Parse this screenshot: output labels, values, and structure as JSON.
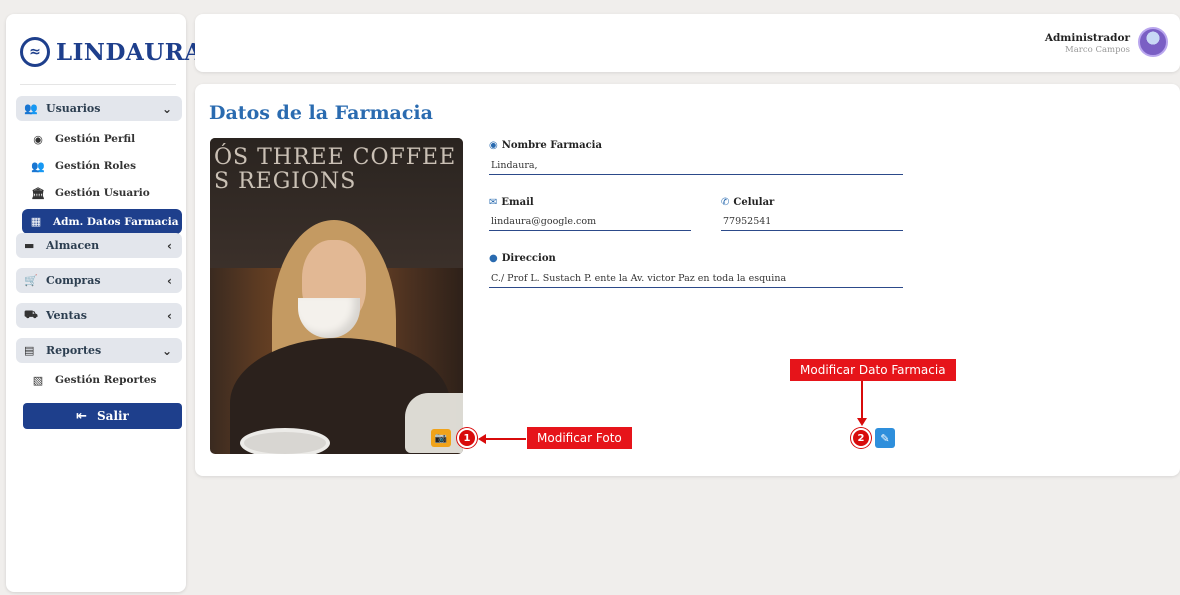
{
  "brand": {
    "name": "LINDAURA",
    "logo_icon": "lindaura-logo-icon"
  },
  "sidebar": {
    "groups": [
      {
        "label": "Usuarios",
        "icon": "users-icon",
        "chevron": "chevron-down-icon"
      },
      {
        "label": "Almacen",
        "icon": "store-icon",
        "chevron": "chevron-left-icon"
      },
      {
        "label": "Compras",
        "icon": "cart-icon",
        "chevron": "chevron-left-icon"
      },
      {
        "label": "Ventas",
        "icon": "dolly-icon",
        "chevron": "chevron-left-icon"
      },
      {
        "label": "Reportes",
        "icon": "report-file-icon",
        "chevron": "chevron-down-icon"
      }
    ],
    "usuarios_items": [
      {
        "label": "Gestión Perfil",
        "icon": "user-circle-icon"
      },
      {
        "label": "Gestión Roles",
        "icon": "user-group-icon"
      },
      {
        "label": "Gestión Usuario",
        "icon": "building-icon"
      },
      {
        "label": "Adm. Datos Farmacia",
        "icon": "clinic-icon",
        "active": true
      }
    ],
    "reportes_items": [
      {
        "label": "Gestión Reportes",
        "icon": "file-chart-icon"
      }
    ],
    "logout_label": "Salir"
  },
  "header": {
    "user_role": "Administrador",
    "user_name": "Marco Campos"
  },
  "page": {
    "title": "Datos de la Farmacia",
    "photo_text": "ÓS THREE COFFEE\nS REGIONS",
    "fields": {
      "nombre": {
        "label": "Nombre Farmacia",
        "value": "Lindaura,"
      },
      "email": {
        "label": "Email",
        "value": "lindaura@google.com"
      },
      "celular": {
        "label": "Celular",
        "value": "77952541"
      },
      "direccion": {
        "label": "Direccion",
        "value": "C./ Prof L. Sustach P. ente la Av. victor Paz en toda la esquina"
      }
    }
  },
  "annotations": {
    "one": {
      "number": "1",
      "text": "Modificar Foto"
    },
    "two": {
      "number": "2",
      "text": "Modificar Dato Farmacia"
    }
  },
  "colors": {
    "primary": "#1e3f8c",
    "title": "#2a6bb0",
    "camera_button": "#f0a31a",
    "edit_button": "#2e8fdc",
    "annotation_red": "#e6141a"
  }
}
